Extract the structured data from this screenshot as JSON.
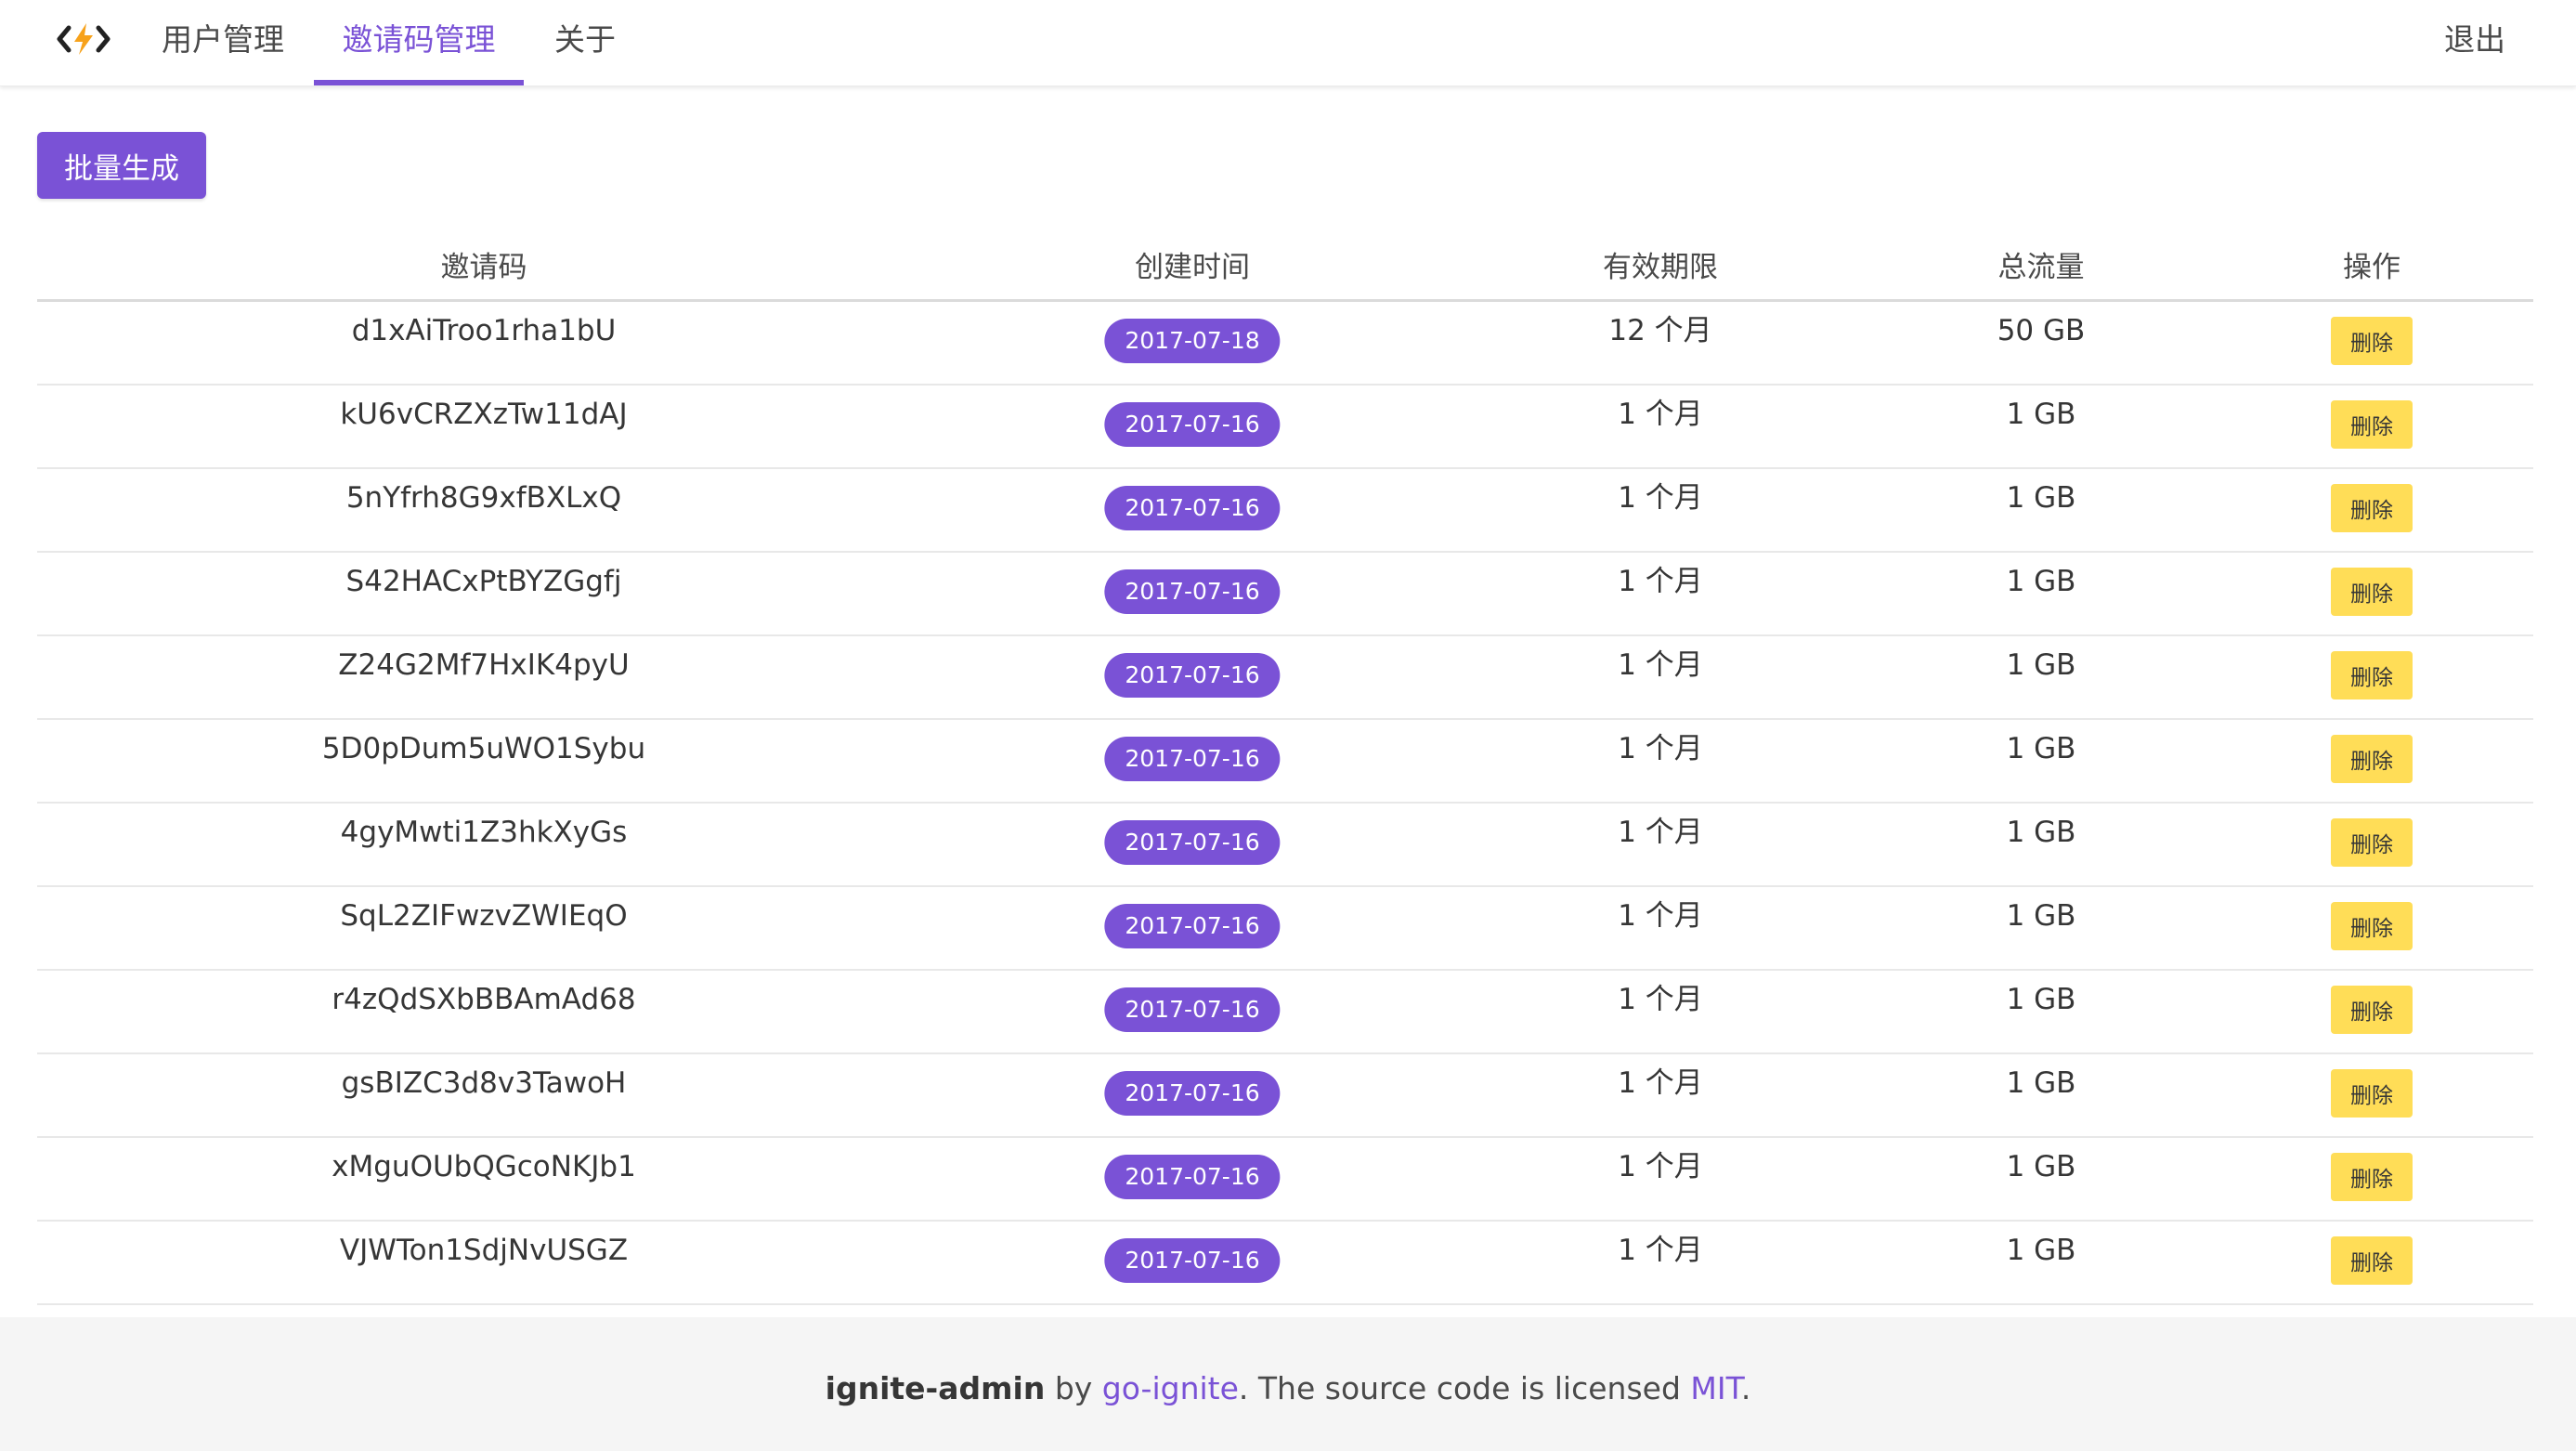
{
  "nav": {
    "tabs": [
      {
        "label": "用户管理"
      },
      {
        "label": "邀请码管理"
      },
      {
        "label": "关于"
      }
    ],
    "active_tab": "邀请码管理",
    "logout_label": "退出"
  },
  "toolbar": {
    "batch_generate_label": "批量生成"
  },
  "table": {
    "headers": {
      "code": "邀请码",
      "created": "创建时间",
      "validity": "有效期限",
      "traffic": "总流量",
      "actions": "操作"
    },
    "delete_label": "删除",
    "rows": [
      {
        "code": "d1xAiTroo1rha1bU",
        "created": "2017-07-18",
        "validity": "12 个月",
        "traffic": "50 GB"
      },
      {
        "code": "kU6vCRZXzTw11dAJ",
        "created": "2017-07-16",
        "validity": "1 个月",
        "traffic": "1 GB"
      },
      {
        "code": "5nYfrh8G9xfBXLxQ",
        "created": "2017-07-16",
        "validity": "1 个月",
        "traffic": "1 GB"
      },
      {
        "code": "S42HACxPtBYZGgfj",
        "created": "2017-07-16",
        "validity": "1 个月",
        "traffic": "1 GB"
      },
      {
        "code": "Z24G2Mf7HxIK4pyU",
        "created": "2017-07-16",
        "validity": "1 个月",
        "traffic": "1 GB"
      },
      {
        "code": "5D0pDum5uWO1Sybu",
        "created": "2017-07-16",
        "validity": "1 个月",
        "traffic": "1 GB"
      },
      {
        "code": "4gyMwti1Z3hkXyGs",
        "created": "2017-07-16",
        "validity": "1 个月",
        "traffic": "1 GB"
      },
      {
        "code": "SqL2ZIFwzvZWIEqO",
        "created": "2017-07-16",
        "validity": "1 个月",
        "traffic": "1 GB"
      },
      {
        "code": "r4zQdSXbBBAmAd68",
        "created": "2017-07-16",
        "validity": "1 个月",
        "traffic": "1 GB"
      },
      {
        "code": "gsBIZC3d8v3TawoH",
        "created": "2017-07-16",
        "validity": "1 个月",
        "traffic": "1 GB"
      },
      {
        "code": "xMguOUbQGcoNKJb1",
        "created": "2017-07-16",
        "validity": "1 个月",
        "traffic": "1 GB"
      },
      {
        "code": "VJWTon1SdjNvUSGZ",
        "created": "2017-07-16",
        "validity": "1 个月",
        "traffic": "1 GB"
      }
    ]
  },
  "footer": {
    "project": "ignite-admin",
    "by": " by ",
    "author_link": "go-ignite",
    "license_text": ". The source code is licensed ",
    "license_link": "MIT",
    "end": "."
  },
  "colors": {
    "accent": "#7a52d6",
    "delete_button": "#ffdd57",
    "footer_bg": "#f5f5f5"
  },
  "icons": {
    "logo": "code-bolt-icon"
  }
}
